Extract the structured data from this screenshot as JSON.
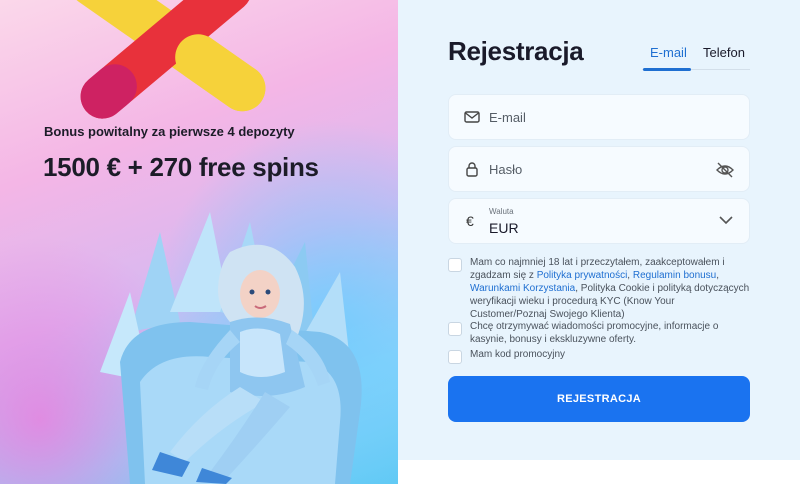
{
  "promo": {
    "subtitle": "Bonus powitalny za pierwsze 4 depozyty",
    "title": "1500 € + 270 free spins"
  },
  "form": {
    "title": "Rejestracja",
    "tabs": [
      {
        "label": "E-mail",
        "active": true
      },
      {
        "label": "Telefon",
        "active": false
      }
    ],
    "email_placeholder": "E-mail",
    "password_placeholder": "Hasło",
    "currency_label": "Waluta",
    "currency_value": "EUR",
    "terms": {
      "t1": "Mam co najmniej 18 lat i przeczytałem, zaakceptowałem i zgadzam się z ",
      "link1": "Polityka prywatności",
      "t2": ", ",
      "link2": "Regulamin bonusu",
      "t3": ", ",
      "link3": "Warunkami Korzystania",
      "t4": ", Polityka Cookie i polityką dotyczących weryfikacji wieku i procedurą KYC (Know Your Customer/Poznaj Swojego Klienta)"
    },
    "promo_consent": "Chcę otrzymywać wiadomości promocyjne, informacje o kasynie, bonusy i ekskluzywne oferty.",
    "promo_code": "Mam kod promocyjny",
    "submit_label": "REJESTRACJA"
  },
  "icons": {
    "email": "mail-icon",
    "password": "lock-icon",
    "currency": "euro-icon",
    "visibility": "eye-off-icon",
    "dropdown": "chevron-down-icon"
  },
  "colors": {
    "accent": "#1a73f0",
    "link": "#1f6fd1",
    "form_bg": "#e8f4fd"
  }
}
